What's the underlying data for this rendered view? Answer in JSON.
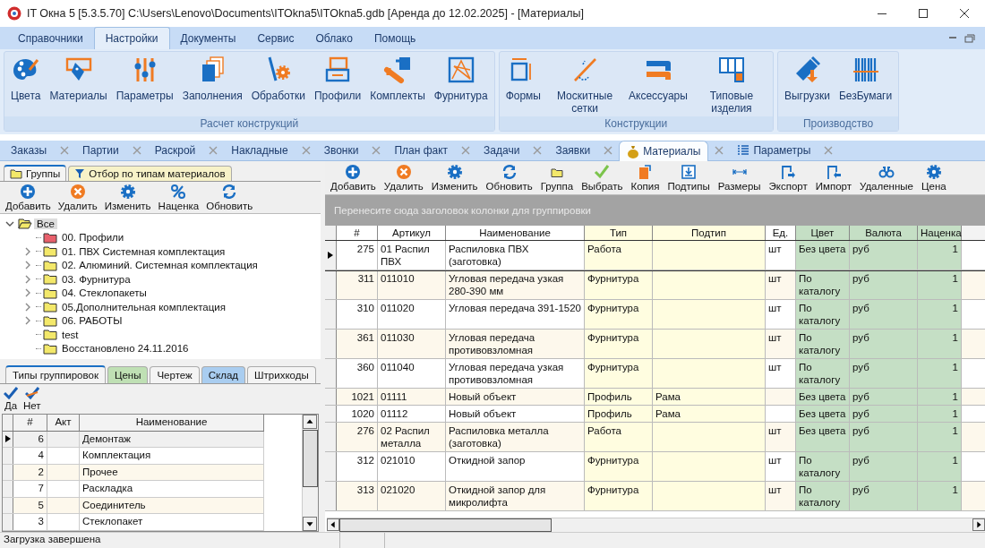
{
  "window": {
    "title": "IT Окна 5 [5.3.5.70] C:\\Users\\Lenovo\\Documents\\ITOkna5\\ITOkna5.gdb [Аренда до 12.02.2025] - [Материалы]"
  },
  "menu_tabs": [
    {
      "label": "Справочники",
      "selected": false
    },
    {
      "label": "Настройки",
      "selected": true
    },
    {
      "label": "Документы",
      "selected": false
    },
    {
      "label": "Сервис",
      "selected": false
    },
    {
      "label": "Облако",
      "selected": false
    },
    {
      "label": "Помощь",
      "selected": false
    }
  ],
  "ribbon": {
    "groups": [
      {
        "label": "Расчет конструкций",
        "buttons": [
          "Цвета",
          "Материалы",
          "Параметры",
          "Заполнения",
          "Обработки",
          "Профили",
          "Комплекты",
          "Фурнитура"
        ]
      },
      {
        "label": "Конструкции",
        "buttons": [
          "Формы",
          "Москитные сетки",
          "Аксессуары",
          "Типовые изделия"
        ]
      },
      {
        "label": "Производство",
        "buttons": [
          "Выгрузки",
          "БезБумаги"
        ]
      }
    ]
  },
  "doc_tabs": [
    {
      "label": "Заказы",
      "selected": false,
      "kind": "plain"
    },
    {
      "label": "Партии",
      "selected": false,
      "kind": "plain"
    },
    {
      "label": "Раскрой",
      "selected": false,
      "kind": "plain"
    },
    {
      "label": "Накладные",
      "selected": false,
      "kind": "plain"
    },
    {
      "label": "Звонки",
      "selected": false,
      "kind": "plain"
    },
    {
      "label": "План факт",
      "selected": false,
      "kind": "plain"
    },
    {
      "label": "Задачи",
      "selected": false,
      "kind": "plain"
    },
    {
      "label": "Заявки",
      "selected": false,
      "kind": "plain"
    },
    {
      "label": "Материалы",
      "selected": true,
      "kind": "bag"
    },
    {
      "label": "Параметры",
      "selected": false,
      "kind": "list"
    }
  ],
  "left_tabs": [
    {
      "label": "Группы",
      "selected": true,
      "kind": "folder"
    },
    {
      "label": "Отбор по типам материалов",
      "selected": false,
      "kind": "filter"
    }
  ],
  "left_toolbar": [
    "Добавить",
    "Удалить",
    "Изменить",
    "Наценка",
    "Обновить"
  ],
  "tree": [
    {
      "label": "Все",
      "selected": true,
      "expanded": true,
      "children": [
        {
          "label": "00. Профили",
          "selected": false,
          "expandable": false,
          "color": "#e8606c"
        },
        {
          "label": "01. ПВХ Системная комплектация",
          "selected": false,
          "expandable": true,
          "color": "#f3e86a"
        },
        {
          "label": "02. Алюминий. Системная комплектация",
          "selected": false,
          "expandable": true,
          "color": "#f3e86a"
        },
        {
          "label": "03. Фурнитура",
          "selected": false,
          "expandable": true,
          "color": "#f3e86a"
        },
        {
          "label": "04. Стеклопакеты",
          "selected": false,
          "expandable": true,
          "color": "#f3e86a"
        },
        {
          "label": "05.Дополнительная комплектация",
          "selected": false,
          "expandable": true,
          "color": "#f3e86a"
        },
        {
          "label": "06. РАБОТЫ",
          "selected": false,
          "expandable": true,
          "color": "#f3e86a"
        },
        {
          "label": "test",
          "selected": false,
          "expandable": false,
          "color": "#f3e86a"
        },
        {
          "label": "Восстановлено 24.11.2016",
          "selected": false,
          "expandable": false,
          "color": "#f3e86a"
        }
      ]
    }
  ],
  "bottom_tabs": [
    {
      "label": "Типы группировок",
      "selected": true,
      "color": "#f4f4f4"
    },
    {
      "label": "Цены",
      "selected": false,
      "color": "#bfe0b4"
    },
    {
      "label": "Чертеж",
      "selected": false,
      "color": "#f4f4f4"
    },
    {
      "label": "Склад",
      "selected": false,
      "color": "#a9cdf0"
    },
    {
      "label": "Штрихкоды",
      "selected": false,
      "color": "#f4f4f4"
    }
  ],
  "confirm_buttons": [
    "Да",
    "Нет"
  ],
  "types_table": {
    "columns": [
      {
        "label": "#",
        "kind": "number"
      },
      {
        "label": "Акт",
        "kind": "text"
      },
      {
        "label": "Наименование",
        "kind": "text"
      }
    ],
    "rows": [
      {
        "selected": true,
        "cells": [
          "6",
          "",
          "Демонтаж"
        ]
      },
      {
        "selected": false,
        "cells": [
          "4",
          "",
          "Комплектация"
        ]
      },
      {
        "selected": false,
        "cells": [
          "2",
          "",
          "Прочее"
        ]
      },
      {
        "selected": false,
        "cells": [
          "7",
          "",
          "Раскладка"
        ]
      },
      {
        "selected": false,
        "cells": [
          "5",
          "",
          "Соединитель"
        ]
      },
      {
        "selected": false,
        "cells": [
          "3",
          "",
          "Стеклопакет"
        ]
      }
    ]
  },
  "toolbar": [
    "Добавить",
    "Удалить",
    "Изменить",
    "Обновить",
    "Группа",
    "Выбрать",
    "Копия",
    "Подтипы",
    "Размеры",
    "Экспорт",
    "Импорт",
    "Удаленные",
    "Цена"
  ],
  "group_panel": {
    "hint": "Перенесите сюда заголовок колонки для группировки"
  },
  "grid": {
    "columns": [
      {
        "label": "#",
        "kind": "number",
        "color": "#ffffff"
      },
      {
        "label": "Артикул",
        "kind": "text",
        "color": "#ffffff"
      },
      {
        "label": "Наименование",
        "kind": "text",
        "color": "#ffffff"
      },
      {
        "label": "Тип",
        "kind": "text",
        "color": "#fffde0"
      },
      {
        "label": "Подтип",
        "kind": "text",
        "color": "#fffde0"
      },
      {
        "label": "Ед.",
        "kind": "text",
        "color": "#ffffff"
      },
      {
        "label": "Цвет",
        "kind": "text",
        "color": "#c5dfc5"
      },
      {
        "label": "Валюта",
        "kind": "text",
        "color": "#c5dfc5"
      },
      {
        "label": "Наценка",
        "kind": "number",
        "color": "#c5dfc5"
      }
    ],
    "rows": [
      {
        "selected": true,
        "cells": [
          "275",
          "01 Распил ПВХ",
          "Распиловка ПВХ (заготовка)",
          "Работа",
          "",
          "шт",
          "Без цвета",
          "руб",
          "1"
        ]
      },
      {
        "selected": false,
        "cells": [
          "311",
          "011010",
          "Угловая передача узкая 280-390 мм",
          "Фурнитура",
          "",
          "шт",
          "По каталогу",
          "руб",
          "1"
        ]
      },
      {
        "selected": false,
        "cells": [
          "310",
          "011020",
          "Угловая передача 391-1520",
          "Фурнитура",
          "",
          "шт",
          "По каталогу",
          "руб",
          "1"
        ]
      },
      {
        "selected": false,
        "cells": [
          "361",
          "011030",
          "Угловая передача противовзломная",
          "Фурнитура",
          "",
          "шт",
          "По каталогу",
          "руб",
          "1"
        ]
      },
      {
        "selected": false,
        "cells": [
          "360",
          "011040",
          "Угловая передача узкая противовзломная",
          "Фурнитура",
          "",
          "шт",
          "По каталогу",
          "руб",
          "1"
        ]
      },
      {
        "selected": false,
        "cells": [
          "1021",
          "01111",
          "Новый объект",
          "Профиль",
          "Рама",
          "",
          "Без цвета",
          "руб",
          "1"
        ]
      },
      {
        "selected": false,
        "cells": [
          "1020",
          "01112",
          "Новый объект",
          "Профиль",
          "Рама",
          "",
          "Без цвета",
          "руб",
          "1"
        ]
      },
      {
        "selected": false,
        "cells": [
          "276",
          "02 Распил металла",
          "Распиловка металла (заготовка)",
          "Работа",
          "",
          "шт",
          "Без цвета",
          "руб",
          "1"
        ]
      },
      {
        "selected": false,
        "cells": [
          "312",
          "021010",
          "Откидной запор",
          "Фурнитура",
          "",
          "шт",
          "По каталогу",
          "руб",
          "1"
        ]
      },
      {
        "selected": false,
        "cells": [
          "313",
          "021020",
          "Откидной запор для микролифта",
          "Фурнитура",
          "",
          "шт",
          "По каталогу",
          "руб",
          "1"
        ]
      }
    ]
  },
  "status_bar": [
    "Загрузка завершена"
  ]
}
